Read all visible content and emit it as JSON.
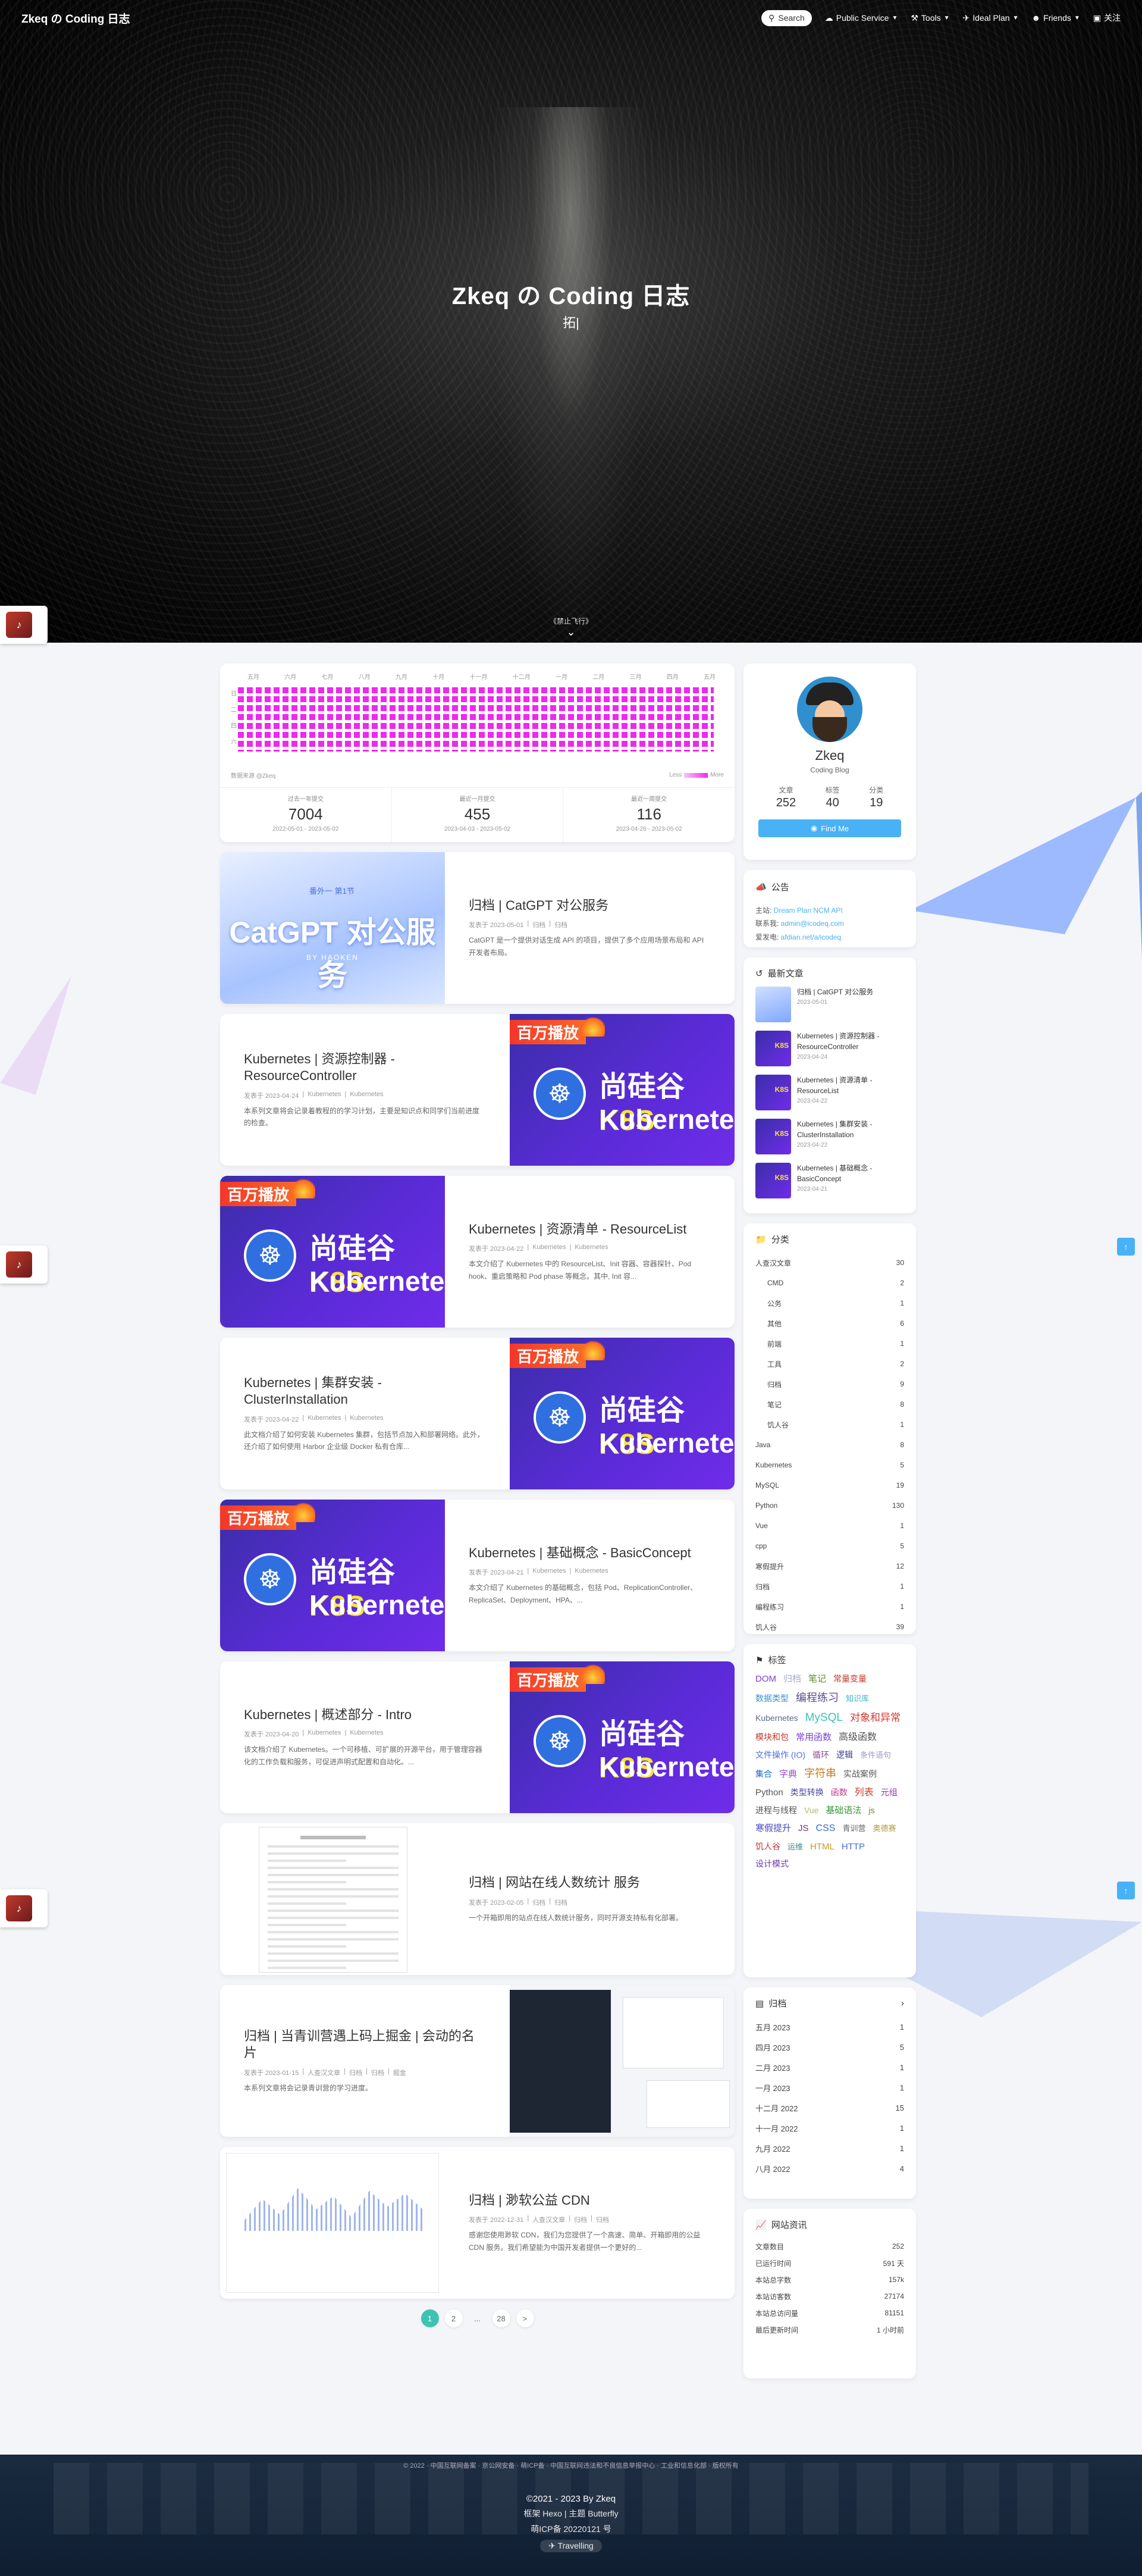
{
  "nav": {
    "brand": "Zkeq の Coding 日志",
    "search": "Search",
    "items": [
      {
        "label": "Public Service",
        "icon": "cloud-icon",
        "dropdown": true
      },
      {
        "label": "Tools",
        "icon": "tools-icon",
        "dropdown": true
      },
      {
        "label": "Ideal Plan",
        "icon": "plane-icon",
        "dropdown": true
      },
      {
        "label": "Friends",
        "icon": "friends-icon",
        "dropdown": true
      },
      {
        "label": "关注",
        "icon": "tv-icon",
        "dropdown": false
      }
    ]
  },
  "hero": {
    "title": "Zkeq の Coding 日志",
    "subtitle": "拓|",
    "scroll_hint": "《禁止飞行》"
  },
  "heatmap": {
    "months": [
      "五月",
      "六月",
      "七月",
      "八月",
      "九月",
      "十月",
      "十一月",
      "十二月",
      "一月",
      "二月",
      "三月",
      "四月",
      "五月"
    ],
    "days": [
      "日",
      "二",
      "四",
      "六"
    ],
    "legend_left": "数据来源 @Zkeq",
    "legend_less": "Less",
    "legend_more": "More",
    "color": "#ee28f0",
    "stats": [
      {
        "label": "过去一年提交",
        "value": "7004",
        "range": "2022-05-01 - 2023-05-02"
      },
      {
        "label": "最近一月提交",
        "value": "455",
        "range": "2023-04-03 - 2023-05-02"
      },
      {
        "label": "最近一周提交",
        "value": "116",
        "range": "2023-04-26 - 2023-05-02"
      }
    ]
  },
  "posts": [
    {
      "title": "归档 | CatGPT 对公服务",
      "meta": [
        "发表于 2023-05-01",
        "归档",
        "归档"
      ],
      "excerpt": "CatGPT 是一个提供对话生成 API 的项目，提供了多个应用场景布局和 API 开发者布局。",
      "cover": "catgpt",
      "side": "left"
    },
    {
      "title": "Kubernetes | 资源控制器 - ResourceController",
      "meta": [
        "发表于 2023-04-24",
        "Kubernetes",
        "Kubernetes"
      ],
      "excerpt": "本系列文章将会记录着教程的的学习计划，主要是知识点和同学们当前进度的检查。",
      "cover": "k8s",
      "side": "right"
    },
    {
      "title": "Kubernetes | 资源清单 - ResourceList",
      "meta": [
        "发表于 2023-04-22",
        "Kubernetes",
        "Kubernetes"
      ],
      "excerpt": "本文介绍了 Kubernetes 中的 ResourceList、Init 容器、容器探针、Pod hook、重启策略和 Pod phase 等概念。其中, Init 容...",
      "cover": "k8s",
      "side": "left"
    },
    {
      "title": "Kubernetes | 集群安装 - ClusterInstallation",
      "meta": [
        "发表于 2023-04-22",
        "Kubernetes",
        "Kubernetes"
      ],
      "excerpt": "此文档介绍了如何安装 Kubernetes 集群，包括节点加入和部署网络。此外，还介绍了如何使用 Harbor 企业级 Docker 私有仓库...",
      "cover": "k8s",
      "side": "right"
    },
    {
      "title": "Kubernetes | 基础概念 - BasicConcept",
      "meta": [
        "发表于 2023-04-21",
        "Kubernetes",
        "Kubernetes"
      ],
      "excerpt": "本文介绍了 Kubernetes 的基础概念，包括 Pod、ReplicationController、ReplicaSet、Deployment、HPA、...",
      "cover": "k8s",
      "side": "left"
    },
    {
      "title": "Kubernetes | 概述部分 - Intro",
      "meta": [
        "发表于 2023-04-20",
        "Kubernetes",
        "Kubernetes"
      ],
      "excerpt": "该文档介绍了 Kubernetes。一个可移植、可扩展的开源平台，用于管理容器化的工作负载和服务，可促进声明式配置和自动化。...",
      "cover": "k8s",
      "side": "right"
    },
    {
      "title": "归档 | 网站在线人数统计 服务",
      "meta": [
        "发表于 2023-02-05",
        "归档",
        "归档"
      ],
      "excerpt": "一个开箱即用的站点在线人数统计服务，同时开源支持私有化部署。",
      "cover": "doc",
      "side": "left"
    },
    {
      "title": "归档 | 当青训营遇上码上掘金 | 会动的名片",
      "meta": [
        "发表于 2023-01-15",
        "人查汉文章",
        "归档",
        "归档",
        "掘金"
      ],
      "excerpt": "本系列文章将会记录青训营的学习进度。",
      "cover": "dash",
      "side": "right"
    },
    {
      "title": "归档 | 渺软公益 CDN",
      "meta": [
        "发表于 2022-12-31",
        "人查汉文章",
        "归档",
        "归档"
      ],
      "excerpt": "感谢您使用渺软 CDN，我们为您提供了一个高速、简单、开箱即用的公益 CDN 服务。我们希望能为中国开发者提供一个更好的...",
      "cover": "cdn",
      "side": "left"
    }
  ],
  "cover_text": {
    "k8s_badge": "百万播放",
    "k8s_line1a": "尚硅谷 ",
    "k8s_line1b": "K8S",
    "k8s_line2": "Kubernetes",
    "catgpt_small": "番外一 第1节",
    "catgpt_big": "CatGPT 对公服务",
    "catgpt_by": "BY HAOKEN"
  },
  "pager": [
    "1",
    "2",
    "...",
    "28",
    ">"
  ],
  "author": {
    "name": "Zkeq",
    "desc": "Coding Blog",
    "stats": [
      {
        "label": "文章",
        "value": "252"
      },
      {
        "label": "标签",
        "value": "40"
      },
      {
        "label": "分类",
        "value": "19"
      }
    ],
    "find_me": "Find Me"
  },
  "notice": {
    "title": "公告",
    "rows": [
      {
        "k": "主站: ",
        "v": "Dream Plan   NCM API"
      },
      {
        "k": "联系我: ",
        "v": "admin@icodeq.com"
      },
      {
        "k": "爱发电: ",
        "v": "afdian.net/a/icodeq"
      }
    ]
  },
  "recent": {
    "title": "最新文章",
    "items": [
      {
        "t": "归档 | CatGPT 对公服务",
        "d": "2023-05-01",
        "cat": true
      },
      {
        "t": "Kubernetes | 资源控制器 - ResourceController",
        "d": "2023-04-24",
        "cat": false
      },
      {
        "t": "Kubernetes | 资源清单 - ResourceList",
        "d": "2023-04-22",
        "cat": false
      },
      {
        "t": "Kubernetes | 集群安装 - ClusterInstallation",
        "d": "2023-04-22",
        "cat": false
      },
      {
        "t": "Kubernetes | 基础概念 - BasicConcept",
        "d": "2023-04-21",
        "cat": false
      }
    ]
  },
  "categories": {
    "title": "分类",
    "rows": [
      {
        "name": "人查汉文章",
        "count": "30",
        "sub": false
      },
      {
        "name": "CMD",
        "count": "2",
        "sub": true
      },
      {
        "name": "公务",
        "count": "1",
        "sub": true
      },
      {
        "name": "其他",
        "count": "6",
        "sub": true
      },
      {
        "name": "前端",
        "count": "1",
        "sub": true
      },
      {
        "name": "工具",
        "count": "2",
        "sub": true
      },
      {
        "name": "归档",
        "count": "9",
        "sub": true
      },
      {
        "name": "笔记",
        "count": "8",
        "sub": true
      },
      {
        "name": "饥人谷",
        "count": "1",
        "sub": true
      },
      {
        "name": "Java",
        "count": "8",
        "sub": false
      },
      {
        "name": "Kubernetes",
        "count": "5",
        "sub": false
      },
      {
        "name": "MySQL",
        "count": "19",
        "sub": false
      },
      {
        "name": "Python",
        "count": "130",
        "sub": false
      },
      {
        "name": "Vue",
        "count": "1",
        "sub": false
      },
      {
        "name": "cpp",
        "count": "5",
        "sub": false
      },
      {
        "name": "寒假提升",
        "count": "12",
        "sub": false
      },
      {
        "name": "归档",
        "count": "1",
        "sub": false
      },
      {
        "name": "编程练习",
        "count": "1",
        "sub": false
      },
      {
        "name": "饥人谷",
        "count": "39",
        "sub": false
      }
    ]
  },
  "tags": {
    "title": "标签",
    "items": [
      {
        "t": "DOM",
        "c": "#7a3fd6",
        "s": 15
      },
      {
        "t": "归档",
        "c": "#a8a8d0",
        "s": 15
      },
      {
        "t": "笔记",
        "c": "#6a8f2a",
        "s": 15
      },
      {
        "t": "常量变量",
        "c": "#c0392b",
        "s": 14
      },
      {
        "t": "数据类型",
        "c": "#3e8fc9",
        "s": 14
      },
      {
        "t": "编程练习",
        "c": "#5a4a8a",
        "s": 18
      },
      {
        "t": "知识库",
        "c": "#3ab3c9",
        "s": 13
      },
      {
        "t": "Kubernetes",
        "c": "#5b6b8a",
        "s": 14
      },
      {
        "t": "MySQL",
        "c": "#3ec3b1",
        "s": 19
      },
      {
        "t": "对象和异常",
        "c": "#d4372c",
        "s": 17
      },
      {
        "t": "模块和包",
        "c": "#c0392b",
        "s": 14
      },
      {
        "t": "常用函数",
        "c": "#7a3fd6",
        "s": 15
      },
      {
        "t": "高级函数",
        "c": "#555",
        "s": 16
      },
      {
        "t": "文件操作 (IO)",
        "c": "#4a6ee0",
        "s": 14
      },
      {
        "t": "循环",
        "c": "#8a4a8a",
        "s": 14
      },
      {
        "t": "逻辑",
        "c": "#3a3a8a",
        "s": 14
      },
      {
        "t": "条件语句",
        "c": "#9a9ac0",
        "s": 13
      },
      {
        "t": "集合",
        "c": "#1a6ac9",
        "s": 14
      },
      {
        "t": "字典",
        "c": "#9a4acb",
        "s": 15
      },
      {
        "t": "字符串",
        "c": "#c77a1a",
        "s": 18
      },
      {
        "t": "实战案例",
        "c": "#555",
        "s": 14
      },
      {
        "t": "Python",
        "c": "#555",
        "s": 15
      },
      {
        "t": "类型转换",
        "c": "#4a4aa0",
        "s": 14
      },
      {
        "t": "函数",
        "c": "#c03a8a",
        "s": 14
      },
      {
        "t": "列表",
        "c": "#d4372c",
        "s": 16
      },
      {
        "t": "元组",
        "c": "#9a2ac0",
        "s": 14
      },
      {
        "t": "进程与线程",
        "c": "#555",
        "s": 14
      },
      {
        "t": "Vue",
        "c": "#b0c070",
        "s": 14
      },
      {
        "t": "基础语法",
        "c": "#3a9a3a",
        "s": 15
      },
      {
        "t": "js",
        "c": "#6a8a2a",
        "s": 14
      },
      {
        "t": "寒假提升",
        "c": "#4a4ac0",
        "s": 15
      },
      {
        "t": "JS",
        "c": "#7a2a8a",
        "s": 15
      },
      {
        "t": "CSS",
        "c": "#3a6ac9",
        "s": 16
      },
      {
        "t": "青训营",
        "c": "#666",
        "s": 13
      },
      {
        "t": "奥德赛",
        "c": "#aaa040",
        "s": 13
      },
      {
        "t": "饥人谷",
        "c": "#c03a3a",
        "s": 14
      },
      {
        "t": "运维",
        "c": "#3a8a8a",
        "s": 13
      },
      {
        "t": "HTML",
        "c": "#c79a2a",
        "s": 15
      },
      {
        "t": "HTTP",
        "c": "#4a6ee0",
        "s": 15
      },
      {
        "t": "设计模式",
        "c": "#6a3ab0",
        "s": 14
      }
    ]
  },
  "archives": {
    "title": "归档",
    "rows": [
      {
        "m": "五月 2023",
        "c": "1"
      },
      {
        "m": "四月 2023",
        "c": "5"
      },
      {
        "m": "二月 2023",
        "c": "1"
      },
      {
        "m": "一月 2023",
        "c": "1"
      },
      {
        "m": "十二月 2022",
        "c": "15"
      },
      {
        "m": "十一月 2022",
        "c": "1"
      },
      {
        "m": "九月 2022",
        "c": "1"
      },
      {
        "m": "八月 2022",
        "c": "4"
      }
    ]
  },
  "site_info": {
    "title": "网站资讯",
    "rows": [
      {
        "k": "文章数目",
        "v": "252"
      },
      {
        "k": "已运行时间",
        "v": "591 天"
      },
      {
        "k": "本站总字数",
        "v": "157k"
      },
      {
        "k": "本站访客数",
        "v": "27174"
      },
      {
        "k": "本站总访问量",
        "v": "81151"
      },
      {
        "k": "最后更新时间",
        "v": "1 小时前"
      }
    ]
  },
  "footer": {
    "links": "© 2022 · 中国互联网备案 · 京公网安备 · 萌ICP备 · 中国互联网违法和不良信息举报中心 · 工业和信息化部 · 版权所有",
    "copyright": "©2021 - 2023 By Zkeq",
    "line2": "框架 Hexo | 主题 Butterfly",
    "line3": "萌ICP备 20220121 号",
    "travel": "Travelling",
    "hint": "《禁止飞行》"
  }
}
